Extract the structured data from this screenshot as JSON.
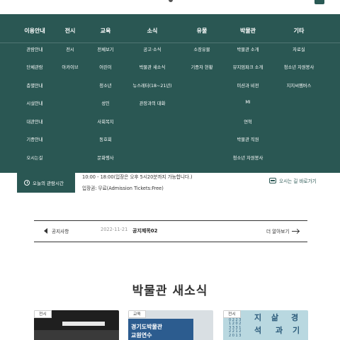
{
  "header": {
    "logo_icon": "museum-logo-icon",
    "menu_icon": "menu-icon"
  },
  "menu": {
    "columns": [
      {
        "title": "이용안내",
        "items": [
          "관람안내",
          "단체관람",
          "층별안내",
          "시설안내",
          "대관안내",
          "기증안내",
          "오시는길"
        ]
      },
      {
        "title": "전시",
        "items": [
          "전시",
          "아카이브"
        ]
      },
      {
        "title": "교육",
        "items": [
          "전체보기",
          "어린이",
          "청소년",
          "성인",
          "사회복지",
          "동호회",
          "문화행사"
        ]
      },
      {
        "title": "소식",
        "items": [
          "공고·소식",
          "박물관 새소식",
          "뉴스레터(18~21년)",
          "관장과의 대화"
        ]
      },
      {
        "title": "유물",
        "items": [
          "소장유물",
          "기증자 현황"
        ]
      },
      {
        "title": "박물관",
        "items": [
          "박물관 소개",
          "뮤지엄파크 소개",
          "미션과 비전",
          "MI",
          "연혁",
          "박물관 직원",
          "청소년 자원봉사"
        ]
      },
      {
        "title": "기타",
        "items": [
          "자료실",
          "청소년 자원봉사",
          "지지씨멤버스"
        ]
      }
    ]
  },
  "info": {
    "hours_label": "오늘의 관람시간",
    "hours_text": "10:00 - 18:00(입장은 오후 5시20분까지 가능합니다.)",
    "ticket_text": "입장권: 무료(Admission Tickets:Free)",
    "directions_label": "오시는 길 바로가기"
  },
  "notice": {
    "label": "공지사항",
    "date": "2022-11-21",
    "title": "공지제목02",
    "more_label": "더 알아보기"
  },
  "news": {
    "title": "박물관 새소식",
    "cards": [
      {
        "tag": "전시"
      },
      {
        "tag": "교육",
        "lines": [
          "경기도박물관",
          "교원연수"
        ]
      },
      {
        "tag": "전시",
        "big1": "지",
        "big2": "삶",
        "big3": "경",
        "big4": "석",
        "big5": "과",
        "big6": "기",
        "numbers": "0 2 2 3 1 2 0 2 3 3 3 1 2 2 1 2 2 0 1 3"
      }
    ]
  },
  "colors": {
    "primary": "#2a5753",
    "text": "#333333",
    "muted": "#999999"
  }
}
